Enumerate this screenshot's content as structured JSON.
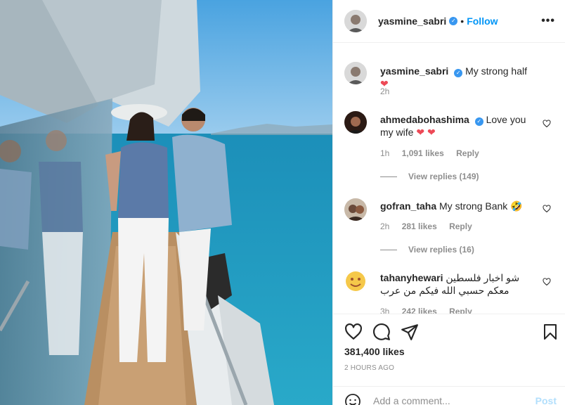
{
  "post": {
    "author": "yasmine_sabri",
    "follow_label": "Follow",
    "dot": "•",
    "more_label": "•••"
  },
  "comments": [
    {
      "user": "yasmine_sabri",
      "verified": true,
      "text": "My strong half",
      "emoji": "❤",
      "time": "2h"
    },
    {
      "user": "ahmedabohashima",
      "verified": true,
      "text": "Love you my wife",
      "emoji": "❤ ❤",
      "time": "1h",
      "likes": "1,091 likes",
      "reply": "Reply",
      "view_replies": "View replies (149)"
    },
    {
      "user": "gofran_taha",
      "verified": false,
      "text": "My strong Bank",
      "emoji": "🤣",
      "time": "2h",
      "likes": "281 likes",
      "reply": "Reply",
      "view_replies": "View replies (16)"
    },
    {
      "user": "tahanyhewari",
      "verified": false,
      "text": "شو اخبار فلسطين معكم حسبي الله فيكم من عرب",
      "time": "3h",
      "likes": "242 likes",
      "reply": "Reply"
    }
  ],
  "stats": {
    "likes": "381,400 likes",
    "time_ago": "2 HOURS AGO"
  },
  "composer": {
    "placeholder": "Add a comment...",
    "post_label": "Post"
  },
  "icons": [
    "heart-icon",
    "comment-icon",
    "share-icon",
    "bookmark-icon",
    "emoji-icon",
    "more-icon",
    "verified-icon"
  ],
  "colors": {
    "accent": "#0095f6",
    "verified": "#3897f0",
    "heart": "#ed4956",
    "muted": "#8e8e8e"
  }
}
